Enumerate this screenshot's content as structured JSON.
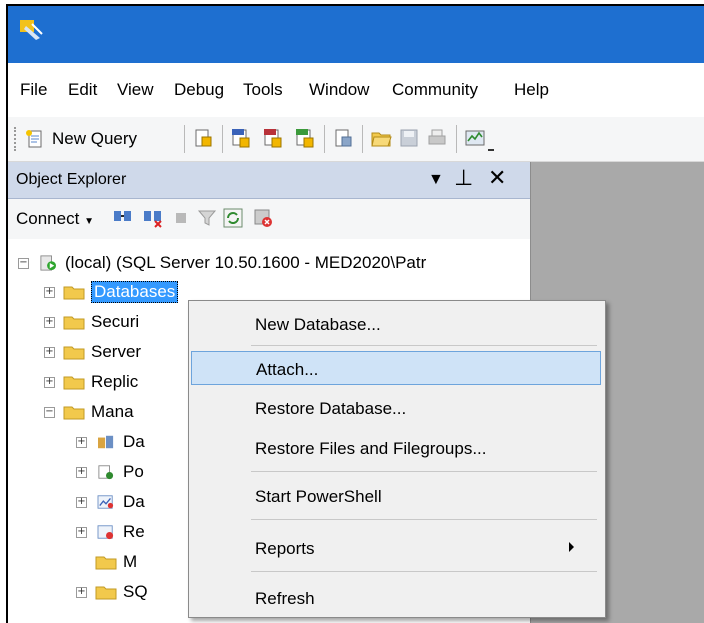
{
  "menubar": {
    "items": [
      "File",
      "Edit",
      "View",
      "Debug",
      "Tools",
      "Window",
      "Community",
      "Help"
    ]
  },
  "toolbar": {
    "new_query_label": "New Query"
  },
  "object_explorer": {
    "title": "Object Explorer",
    "connect_label": "Connect",
    "server_node": "(local) (SQL Server 10.50.1600 - MED2020\\Patr",
    "tree_nodes": [
      "Databases",
      "Securi",
      "Server",
      "Replic",
      "Mana",
      "Da",
      "Po",
      "Da",
      "Re",
      "M",
      "SQ"
    ]
  },
  "context_menu": {
    "items": [
      "New Database...",
      "Attach...",
      "Restore Database...",
      "Restore Files and Filegroups...",
      "Start PowerShell",
      "Reports",
      "Refresh"
    ],
    "highlighted": "Attach..."
  },
  "colors": {
    "titlebar": "#1e6fd0",
    "oe_header": "#cfd9ea",
    "selection": "#3399ff",
    "context_highlight": "#cfe3f7"
  }
}
